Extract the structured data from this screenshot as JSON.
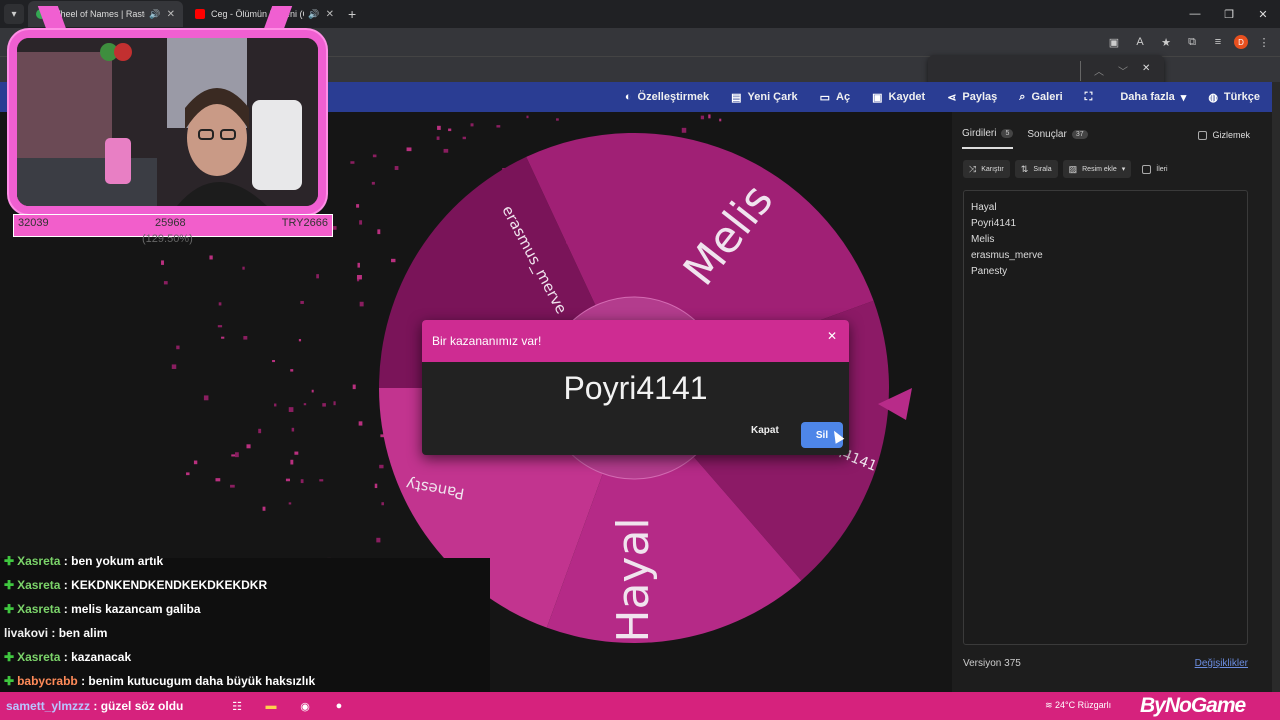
{
  "browser": {
    "tabs": [
      {
        "title": "Wheel of Names | Rastgele",
        "favicon_color": "#34a853",
        "active": true
      },
      {
        "title": "Ceg - Ölümün Kuzeni (Offi",
        "favicon_color": "#ff0000",
        "active": false
      }
    ],
    "new_tab": "+",
    "window_controls": [
      "—",
      "❐",
      "✕"
    ],
    "find_bar": {
      "prev": "︿",
      "next": "﹀",
      "close": "✕"
    }
  },
  "nav": {
    "items": [
      {
        "label": "Özelleştirmek",
        "icon": "palette-icon"
      },
      {
        "label": "Yeni Çark",
        "icon": "document-icon"
      },
      {
        "label": "Aç",
        "icon": "folder-icon"
      },
      {
        "label": "Kaydet",
        "icon": "save-icon"
      },
      {
        "label": "Paylaş",
        "icon": "share-icon"
      },
      {
        "label": "Galeri",
        "icon": "search-icon"
      },
      {
        "label": "",
        "icon": "fullscreen-icon"
      },
      {
        "label": "Daha fazla",
        "icon": "chevron-down-icon"
      },
      {
        "label": "Türkçe",
        "icon": "globe-icon"
      }
    ]
  },
  "wheel": {
    "colors": [
      "#8c1a66",
      "#b52a87",
      "#c2348f",
      "#7a1459",
      "#a02075"
    ],
    "segments": [
      "Melis",
      "Poyri4141",
      "Hayal",
      "Panesty",
      "erasmus_merve"
    ]
  },
  "panel": {
    "tabs": [
      {
        "label": "Girdileri",
        "count": "5"
      },
      {
        "label": "Sonuçlar",
        "count": "37"
      }
    ],
    "hide_label": "Gizlemek",
    "tools": {
      "shuffle": "Karıştır",
      "sort": "Sırala",
      "add_image": "Resim ekle",
      "advanced": "İleri"
    },
    "entries": [
      "Hayal",
      "Poyri4141",
      "Melis",
      "erasmus_merve",
      "Panesty"
    ],
    "version": "Versiyon 375",
    "changes": "Değişiklikler"
  },
  "dialog": {
    "title": "Bir kazananımız var!",
    "winner": "Poyri4141",
    "close_label": "Kapat",
    "delete_label": "Sil",
    "close_icon": "✕"
  },
  "overlay": {
    "stat_left": "32039",
    "stat_mid": "25968",
    "stat_right": "TRY2666",
    "stat_sub": "(129.50%)"
  },
  "chat": [
    {
      "user": "Xasreta",
      "text": ": ben yokum artık",
      "style": "u-green",
      "icon": true
    },
    {
      "user": "Xasreta",
      "text": ": KEKDNKENDKENDKEKDKEKDKR",
      "style": "u-green",
      "icon": true
    },
    {
      "user": "Xasreta",
      "text": ": melis kazancam galiba",
      "style": "u-green",
      "icon": true
    },
    {
      "user": "livakovi",
      "text": ": ben alim",
      "style": "u-plain",
      "icon": false
    },
    {
      "user": "Xasreta",
      "text": ": kazanacak",
      "style": "u-green",
      "icon": true
    },
    {
      "user": "babycrabb",
      "text": ": benim kutucugum daha büyük haksızlık",
      "style": "u-orange",
      "icon": true
    }
  ],
  "taskbar": {
    "chat_user": "samett_ylmzzz",
    "chat_text": ": güzel söz oldu",
    "weather": "24°C  Rüzgarlı",
    "logo": "ByNoGame"
  }
}
